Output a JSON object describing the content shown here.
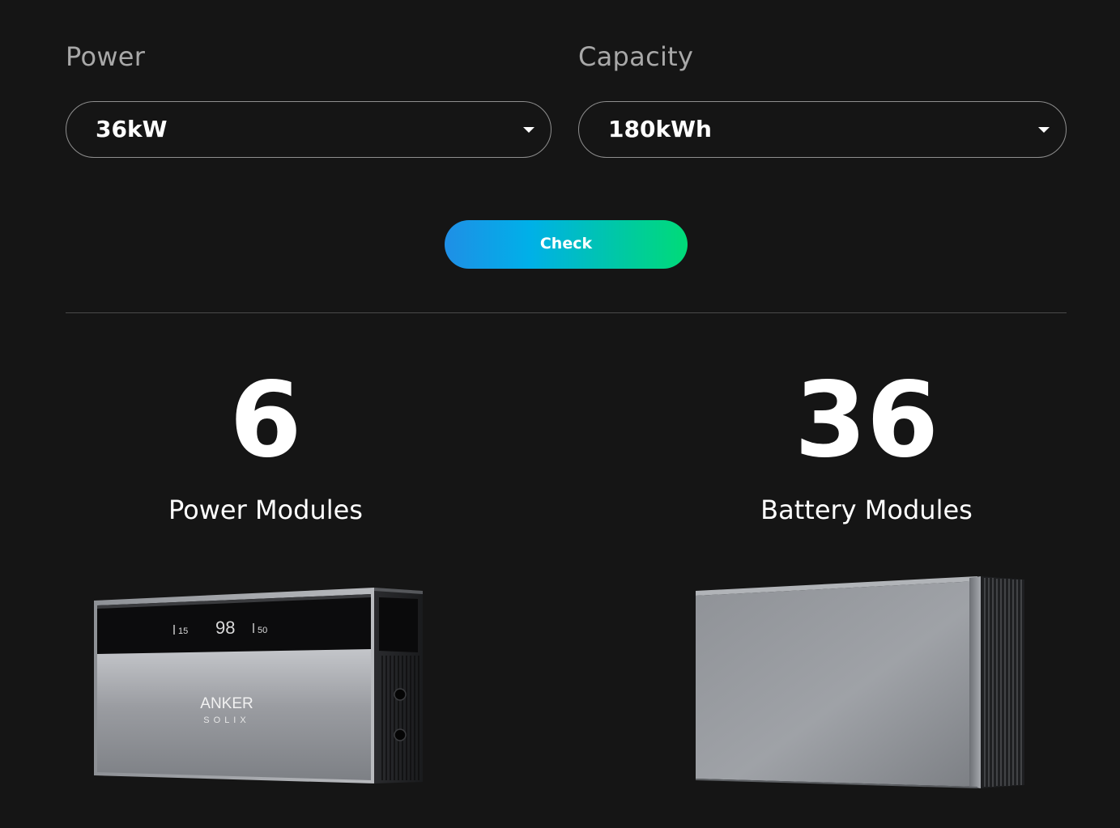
{
  "form": {
    "power": {
      "label": "Power",
      "value": "36kW"
    },
    "capacity": {
      "label": "Capacity",
      "value": "180kWh"
    },
    "check_label": "Check"
  },
  "results": {
    "power_modules": {
      "count": "6",
      "label": "Power Modules"
    },
    "battery_modules": {
      "count": "36",
      "label": "Battery Modules"
    }
  },
  "power_unit_display": {
    "brand_line1": "ANKER",
    "brand_line2": "SOLIX",
    "readout_left": "15",
    "readout_center": "98",
    "readout_right": "50"
  },
  "colors": {
    "background": "#151515",
    "check_gradient_start": "#1f8fe6",
    "check_gradient_end": "#00db78"
  }
}
